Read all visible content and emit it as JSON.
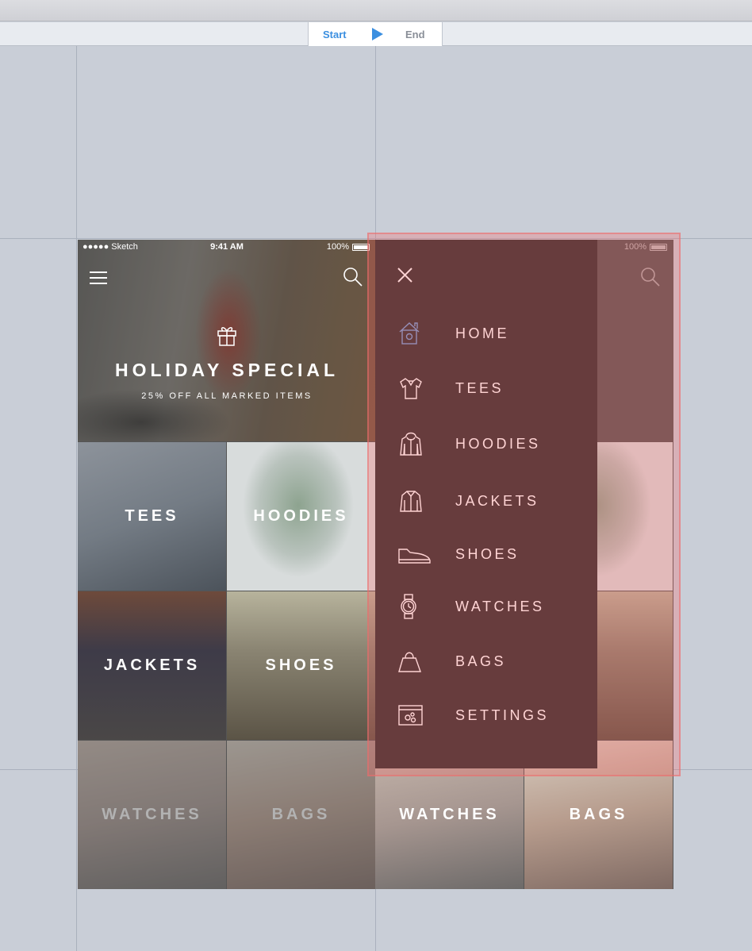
{
  "timeline": {
    "start_label": "Start",
    "end_label": "End"
  },
  "status_bar": {
    "carrier": "●●●●● Sketch",
    "time": "9:41 AM",
    "battery": "100%"
  },
  "hero": {
    "title": "HOLIDAY SPECIAL",
    "subtitle": "25% OFF ALL MARKED ITEMS"
  },
  "categories": [
    {
      "label": "TEES"
    },
    {
      "label": "HOODIES"
    },
    {
      "label": "JACKETS"
    },
    {
      "label": "SHOES"
    },
    {
      "label": "WATCHES"
    },
    {
      "label": "BAGS"
    }
  ],
  "drawer": {
    "items": [
      {
        "label": "HOME",
        "icon": "home-icon"
      },
      {
        "label": "TEES",
        "icon": "tee-icon"
      },
      {
        "label": "HOODIES",
        "icon": "hoodie-icon"
      },
      {
        "label": "JACKETS",
        "icon": "jacket-icon"
      },
      {
        "label": "SHOES",
        "icon": "shoe-icon"
      },
      {
        "label": "WATCHES",
        "icon": "watch-icon"
      },
      {
        "label": "BAGS",
        "icon": "bag-icon"
      },
      {
        "label": "SETTINGS",
        "icon": "settings-icon"
      }
    ]
  },
  "colors": {
    "accent": "#3b8fe0",
    "canvas": "#c9ced7",
    "drawer_bg": "#2f2f31",
    "home_icon": "#6f9fd8",
    "hotspot": "#ff5f5f"
  }
}
